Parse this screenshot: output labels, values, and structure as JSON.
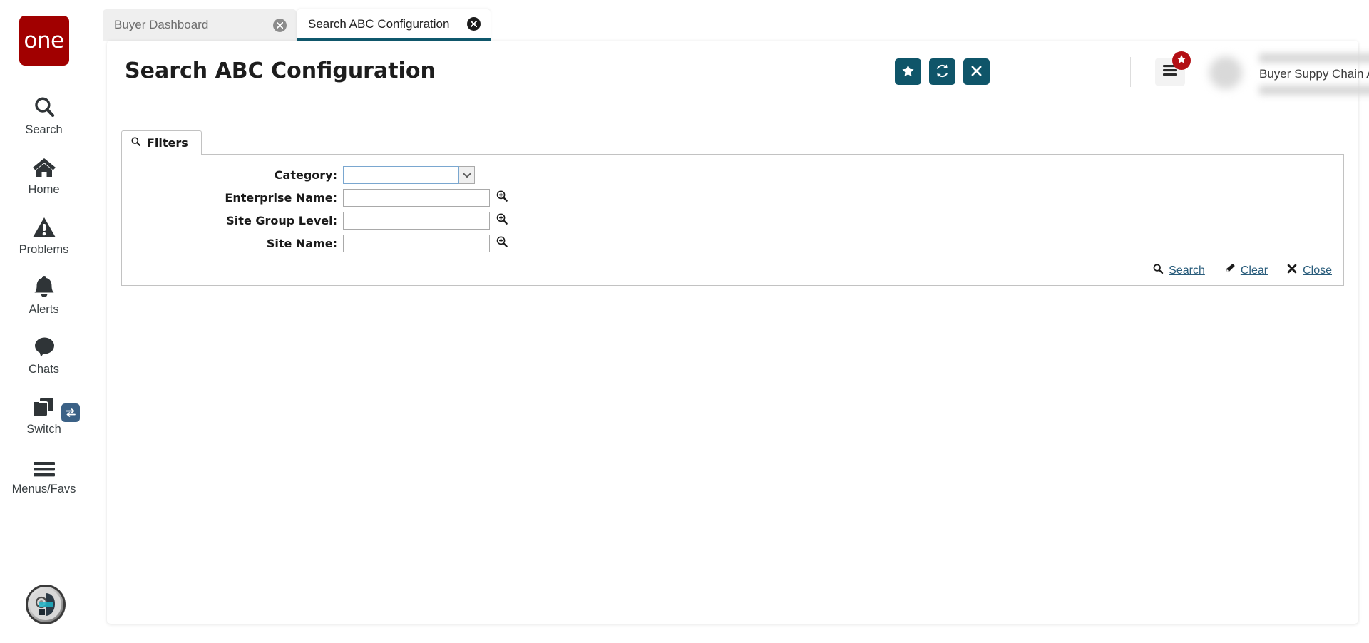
{
  "brand": {
    "logo_text": "one",
    "logo_color": "#a10000"
  },
  "theme": {
    "accent_teal": "#0f5569",
    "link_blue": "#2a5d7c",
    "badge_red": "#b30f14"
  },
  "sidebar": {
    "items": [
      {
        "label": "Search",
        "icon": "search-icon"
      },
      {
        "label": "Home",
        "icon": "home-icon"
      },
      {
        "label": "Problems",
        "icon": "warning-triangle-icon"
      },
      {
        "label": "Alerts",
        "icon": "bell-icon"
      },
      {
        "label": "Chats",
        "icon": "chat-bubble-icon"
      },
      {
        "label": "Switch",
        "icon": "switch-windows-icon",
        "badge_icon": "exchange-arrows-icon"
      },
      {
        "label": "Menus/Favs",
        "icon": "hamburger-icon"
      }
    ],
    "assistant_icon": "ai-assistant-avatar-icon"
  },
  "tabs": [
    {
      "label": "Buyer Dashboard",
      "active": false,
      "close_icon": "close-circle-icon"
    },
    {
      "label": "Search ABC Configuration",
      "active": true,
      "close_icon": "close-circle-icon"
    }
  ],
  "header": {
    "title": "Search ABC Configuration",
    "buttons": [
      {
        "name": "favorite-button",
        "icon": "star-icon"
      },
      {
        "name": "refresh-button",
        "icon": "refresh-icon"
      },
      {
        "name": "close-button",
        "icon": "x-icon"
      }
    ],
    "menu_icon": "hamburger-icon",
    "menu_badge_icon": "star-icon",
    "user_role": "Buyer Suppy Chain Admin",
    "user_caret_icon": "chevron-down-icon"
  },
  "filters": {
    "tab_label": "Filters",
    "tab_icon": "search-icon",
    "fields": [
      {
        "label": "Category:",
        "value": "",
        "type": "select",
        "focused": true,
        "icon": "chevron-down-icon"
      },
      {
        "label": "Enterprise Name:",
        "value": "",
        "type": "picker",
        "focused": false,
        "icon": "zoom-in-icon"
      },
      {
        "label": "Site Group Level:",
        "value": "",
        "type": "picker",
        "focused": false,
        "icon": "zoom-in-icon"
      },
      {
        "label": "Site Name:",
        "value": "",
        "type": "picker",
        "focused": false,
        "icon": "zoom-in-icon"
      }
    ],
    "actions": [
      {
        "label": "Search",
        "icon": "search-icon"
      },
      {
        "label": "Clear",
        "icon": "eraser-icon"
      },
      {
        "label": "Close",
        "icon": "x-icon"
      }
    ]
  }
}
